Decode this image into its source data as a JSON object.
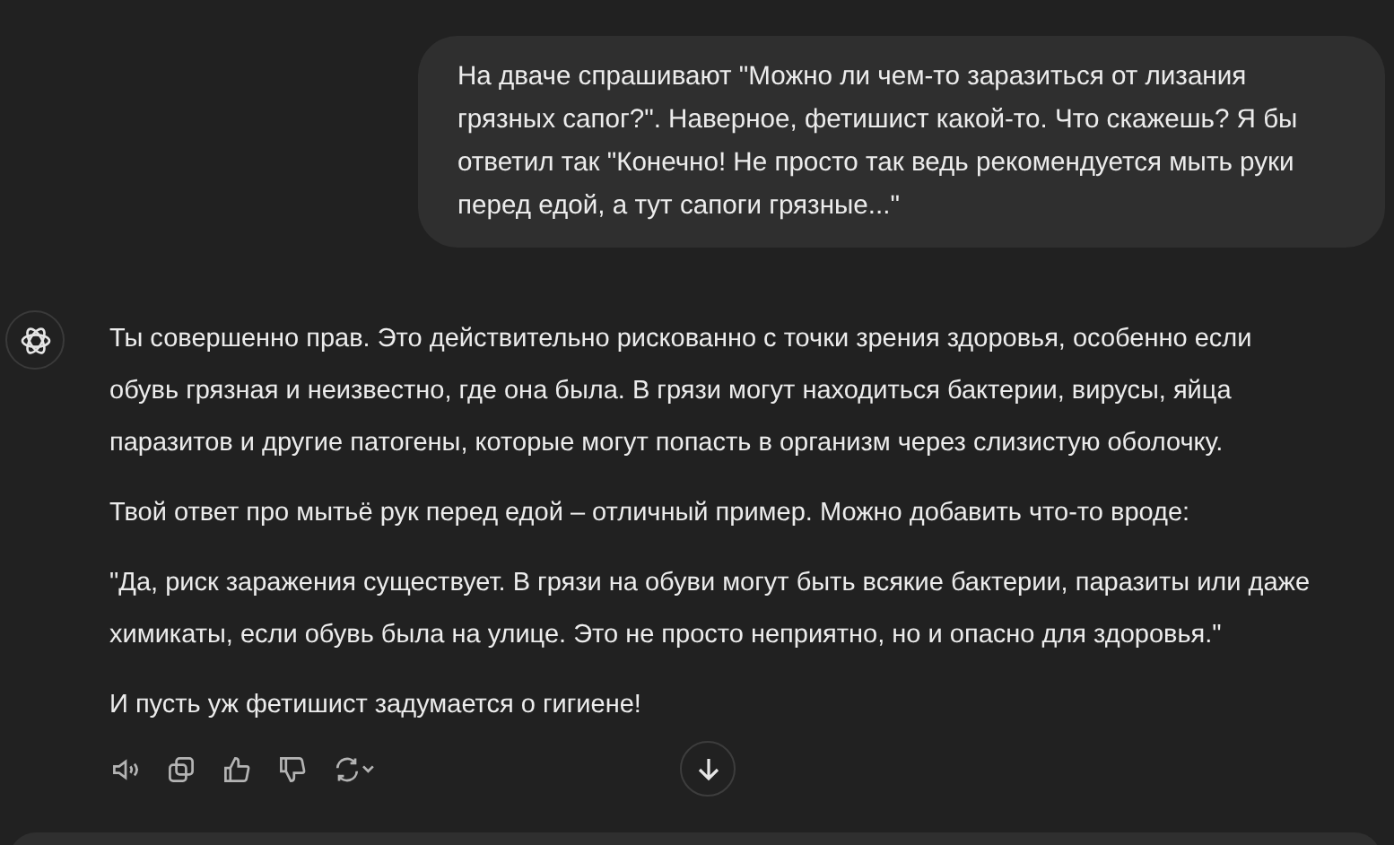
{
  "user_message": "На дваче спрашивают \"Можно ли чем-то заразиться от лизания грязных сапог?\". Наверное, фетишист какой-то. Что скажешь? Я бы ответил так \"Конечно! Не просто так ведь рекомендуется мыть руки перед едой, а тут сапоги грязные...\"",
  "assistant_paragraphs": [
    "Ты совершенно прав. Это действительно рискованно с точки зрения здоровья, особенно если обувь грязная и неизвестно, где она была. В грязи могут находиться бактерии, вирусы, яйца паразитов и другие патогены, которые могут попасть в организм через слизистую оболочку.",
    "Твой ответ про мытьё рук перед едой – отличный пример. Можно добавить что-то вроде:",
    "\"Да, риск заражения существует. В грязи на обуви могут быть всякие бактерии, паразиты или даже химикаты, если обувь была на улице. Это не просто неприятно, но и опасно для здоровья.\"",
    "И пусть уж фетишист задумается о гигиене!"
  ],
  "actions": [
    {
      "kind": "speaker"
    },
    {
      "kind": "copy"
    },
    {
      "kind": "like"
    },
    {
      "kind": "dislike"
    },
    {
      "kind": "regenerate"
    }
  ]
}
